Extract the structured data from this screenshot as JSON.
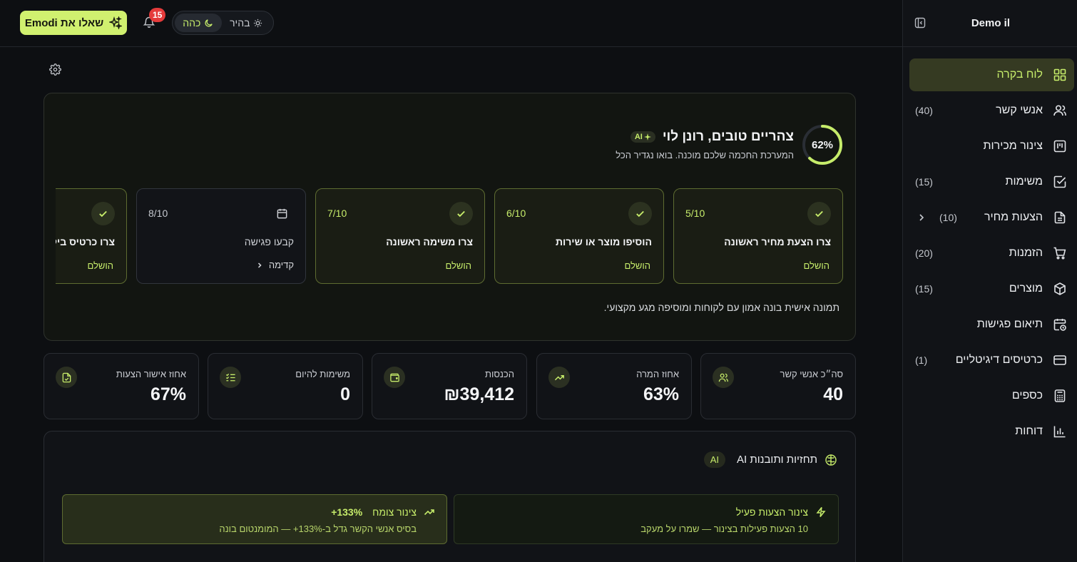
{
  "sidebar": {
    "brand": "Demo il",
    "items": [
      {
        "label": "לוח בקרה",
        "count": ""
      },
      {
        "label": "אנשי קשר",
        "count": "(40)"
      },
      {
        "label": "צינור מכירות",
        "count": ""
      },
      {
        "label": "משימות",
        "count": "(15)"
      },
      {
        "label": "הצעות מחיר",
        "count": "(10)"
      },
      {
        "label": "הזמנות",
        "count": "(20)"
      },
      {
        "label": "מוצרים",
        "count": "(15)"
      },
      {
        "label": "תיאום פגישות",
        "count": ""
      },
      {
        "label": "כרטיסים דיגיטליים",
        "count": "(1)"
      },
      {
        "label": "כספים",
        "count": ""
      },
      {
        "label": "דוחות",
        "count": ""
      }
    ]
  },
  "topbar": {
    "ask_label": "שאלו את Emodi",
    "notifications_count": "15",
    "theme_dark": "כהה",
    "theme_light": "בהיר"
  },
  "welcome": {
    "progress": "62%",
    "progress_value": 0.62,
    "title": "צהריים טובים, רונן לוי",
    "ai_chip": "AI",
    "subtitle": "המערכת החכמה שלכם מוכנה. בואו נגדיר הכל",
    "steps": [
      {
        "title": "צרו הצעת מחיר ראשונה",
        "fraction": "5/10",
        "status": "הושלם"
      },
      {
        "title": "הוסיפו מוצר או שירות",
        "fraction": "6/10",
        "status": "הושלם"
      },
      {
        "title": "צרו משימה ראשונה",
        "fraction": "7/10",
        "status": "הושלם"
      },
      {
        "title": "קבעו פגישה",
        "fraction": "8/10",
        "action": "קדימה"
      },
      {
        "title": "צרו כרטיס ביקור",
        "status": "הושלם"
      }
    ],
    "footer": "תמונה אישית בונה אמון עם לקוחות ומוסיפה מגע מקצועי."
  },
  "stats": [
    {
      "label": "סה״כ אנשי קשר",
      "value": "40"
    },
    {
      "label": "אחוז המרה",
      "value": "63%"
    },
    {
      "label": "הכנסות",
      "value": "₪39,412"
    },
    {
      "label": "משימות להיום",
      "value": "0"
    },
    {
      "label": "אחוז אישור הצעות",
      "value": "67%"
    }
  ],
  "ai": {
    "title": "תחזיות ותובנות AI",
    "badge": "AI",
    "insights": [
      {
        "title": "צינור הצעות פעיל",
        "subtitle": "10 הצעות פעילות בצינור — שמרו על מעקב"
      },
      {
        "title": "צינור צומח",
        "extra": "+133%",
        "subtitle": "בסיס אנשי הקשר גדל ב-133%+ — המומנטום בונה"
      }
    ]
  },
  "colors": {
    "accent": "#c6ec6a",
    "background": "#0d0f12",
    "badge": "#e53b3b"
  }
}
